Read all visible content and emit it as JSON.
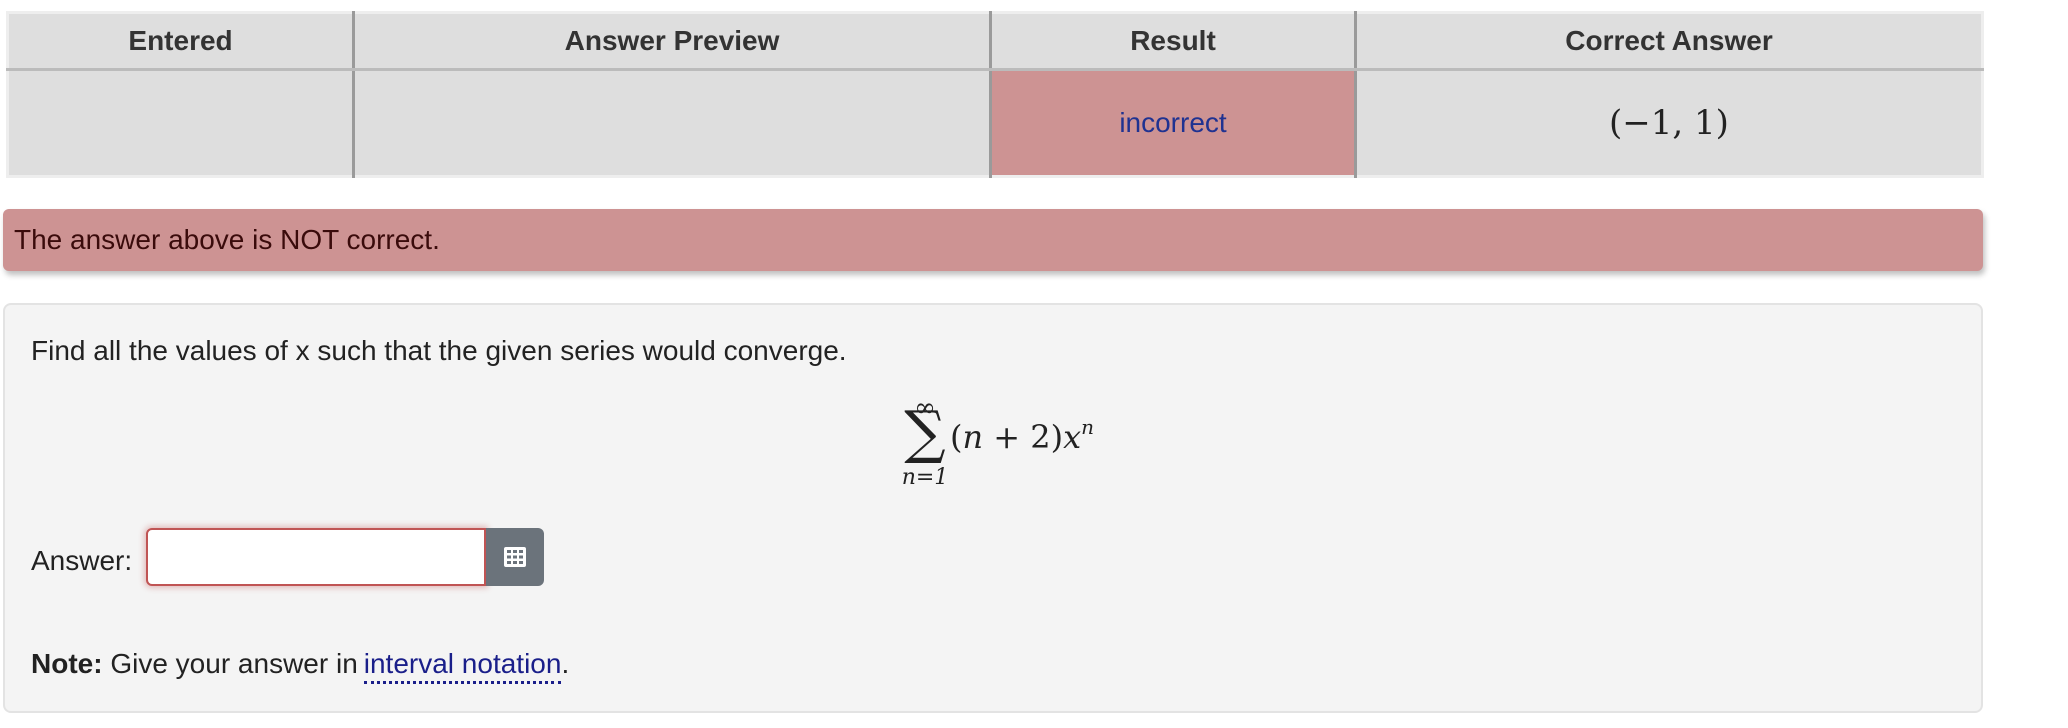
{
  "results_table": {
    "headers": {
      "entered": "Entered",
      "preview": "Answer Preview",
      "result": "Result",
      "correct": "Correct Answer"
    },
    "row": {
      "entered": "",
      "preview": "",
      "result": "incorrect",
      "correct": "(−1, 1)"
    }
  },
  "alert": {
    "message": "The answer above is NOT correct."
  },
  "problem": {
    "prompt": "Find all the values of x such that the given series would converge.",
    "formula": {
      "upper": "∞",
      "sigma": "∑",
      "lower": "n=1",
      "body_open": "(",
      "body_n": "n",
      "body_plus": " + 2)",
      "body_x": "x",
      "exponent": "n"
    },
    "answer_label": "Answer:",
    "answer_value": "",
    "answer_placeholder": "",
    "grid_button_icon": "grid-icon",
    "note_label": "Note:",
    "note_text": "Give your answer in",
    "note_link": "interval notation",
    "note_end": "."
  },
  "colors": {
    "incorrect_bg": "#cd9393",
    "link": "#1a1f8a",
    "button": "#6b737b"
  }
}
